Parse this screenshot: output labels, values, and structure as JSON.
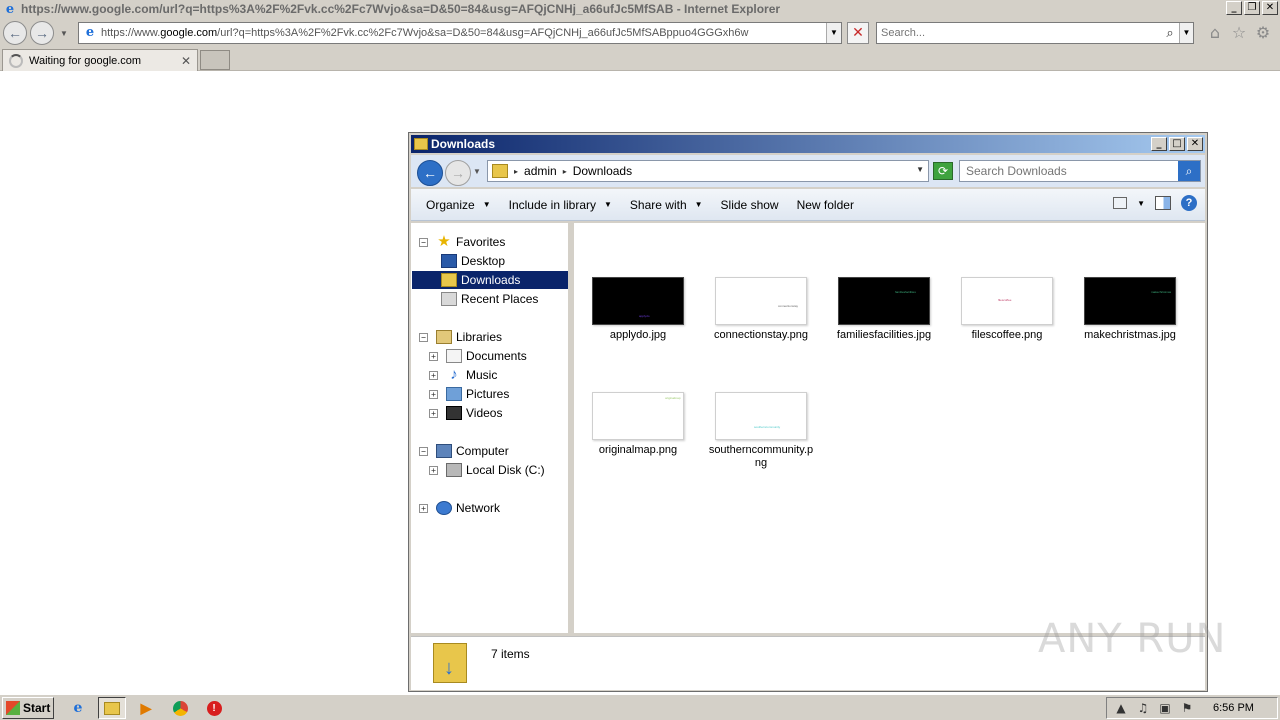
{
  "ie": {
    "title": "https://www.google.com/url?q=https%3A%2F%2Fvk.cc%2Fc7Wvjo&sa=D&50=84&usg=AFQjCNHj_a66ufJc5MfSAB - Internet Explorer",
    "url_prefix": "https://www.",
    "url_domain": "google.com",
    "url_rest": "/url?q=https%3A%2F%2Fvk.cc%2Fc7Wvjo&sa=D&50=84&usg=AFQjCNHj_a66ufJc5MfSABppuo4GGGxh6w",
    "search_placeholder": "Search...",
    "tab_label": "Waiting for google.com"
  },
  "explorer": {
    "title": "Downloads",
    "breadcrumb": [
      "admin",
      "Downloads"
    ],
    "search_placeholder": "Search Downloads",
    "toolbar": {
      "organize": "Organize",
      "include_in_library": "Include in library",
      "share_with": "Share with",
      "slide_show": "Slide show",
      "new_folder": "New folder"
    },
    "nav": {
      "favorites": "Favorites",
      "desktop": "Desktop",
      "downloads": "Downloads",
      "recent_places": "Recent Places",
      "libraries": "Libraries",
      "documents": "Documents",
      "music": "Music",
      "pictures": "Pictures",
      "videos": "Videos",
      "computer": "Computer",
      "local_disk": "Local Disk (C:)",
      "network": "Network"
    },
    "files": [
      {
        "name": "applydo.jpg",
        "thumb": "dark",
        "thumb_text": "applydo",
        "thumb_color": "#6a3ad8"
      },
      {
        "name": "connectionstay.png",
        "thumb": "light",
        "thumb_text": "connectionstay",
        "thumb_color": "#666666"
      },
      {
        "name": "familiesfacilities.jpg",
        "thumb": "dark",
        "thumb_text": "familiesfacilities",
        "thumb_color": "#3aa878"
      },
      {
        "name": "filescoffee.png",
        "thumb": "light",
        "thumb_text": "filescoffee",
        "thumb_color": "#c0406a"
      },
      {
        "name": "makechristmas.jpg",
        "thumb": "dark",
        "thumb_text": "makechristmas",
        "thumb_color": "#3aa878"
      },
      {
        "name": "originalmap.png",
        "thumb": "light",
        "thumb_text": "originalmap",
        "thumb_color": "#9ac86a"
      },
      {
        "name": "southerncommunity.png",
        "thumb": "light",
        "thumb_text": "southerncommunity",
        "thumb_color": "#4ac8c8"
      }
    ],
    "item_count": "7 items"
  },
  "watermark": "ANY RUN",
  "taskbar": {
    "start": "Start",
    "clock": "6:56 PM"
  }
}
